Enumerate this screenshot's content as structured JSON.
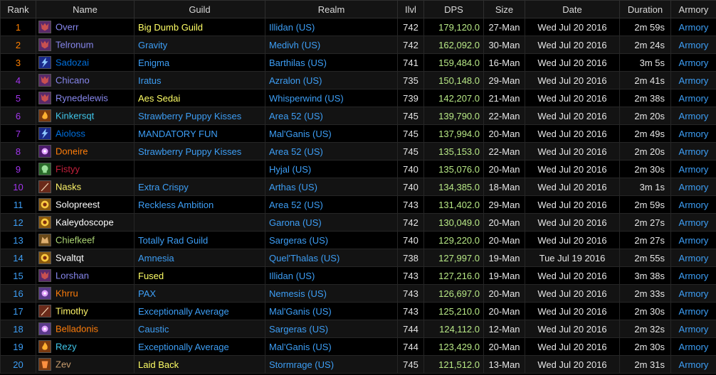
{
  "headers": {
    "rank": "Rank",
    "name": "Name",
    "guild": "Guild",
    "realm": "Realm",
    "ilvl": "Ilvl",
    "dps": "DPS",
    "size": "Size",
    "date": "Date",
    "duration": "Duration",
    "armory": "Armory"
  },
  "colors": {
    "legendary": "#ff8000",
    "epic": "#a335ee",
    "rare": "#0070dd",
    "uncommon": "#1eff00",
    "guild_plain": "#3d9ef5",
    "guild_yellow": "#ffff66",
    "realm": "#3d9ef5",
    "dps": "#b8e986"
  },
  "rows": [
    {
      "rank": "1",
      "name": "Overr",
      "name_color": "#8787ed",
      "icon": "demon-icon",
      "icon_color": "#5a2a6a",
      "guild": "Big Dumb Guild",
      "guild_color": "#ffff66",
      "realm": "Illidan (US)",
      "ilvl": "742",
      "dps": "179,120.0",
      "size": "27-Man",
      "date": "Wed Jul 20 2016",
      "duration": "2m 59s",
      "armory": "Armory",
      "rank_color": "#ff8000"
    },
    {
      "rank": "2",
      "name": "Telronum",
      "name_color": "#8787ed",
      "icon": "demon-icon",
      "icon_color": "#5a2a6a",
      "guild": "Gravity",
      "guild_color": "#3d9ef5",
      "realm": "Medivh (US)",
      "ilvl": "742",
      "dps": "162,092.0",
      "size": "30-Man",
      "date": "Wed Jul 20 2016",
      "duration": "2m 24s",
      "armory": "Armory",
      "rank_color": "#ff8000"
    },
    {
      "rank": "3",
      "name": "Sadozai",
      "name_color": "#0070de",
      "icon": "lightning-icon",
      "icon_color": "#1a2a8a",
      "guild": "Enigma",
      "guild_color": "#3d9ef5",
      "realm": "Barthilas (US)",
      "ilvl": "741",
      "dps": "159,484.0",
      "size": "16-Man",
      "date": "Wed Jul 20 2016",
      "duration": "3m 5s",
      "armory": "Armory",
      "rank_color": "#ff8000"
    },
    {
      "rank": "4",
      "name": "Chicano",
      "name_color": "#8787ed",
      "icon": "demon-icon",
      "icon_color": "#5a2a6a",
      "guild": "Iratus",
      "guild_color": "#3d9ef5",
      "realm": "Azralon (US)",
      "ilvl": "735",
      "dps": "150,148.0",
      "size": "29-Man",
      "date": "Wed Jul 20 2016",
      "duration": "2m 41s",
      "armory": "Armory",
      "rank_color": "#a335ee"
    },
    {
      "rank": "5",
      "name": "Rynedelewis",
      "name_color": "#8787ed",
      "icon": "demon-icon",
      "icon_color": "#5a2a6a",
      "guild": "Aes Sedai",
      "guild_color": "#ffff66",
      "realm": "Whisperwind (US)",
      "ilvl": "739",
      "dps": "142,207.0",
      "size": "21-Man",
      "date": "Wed Jul 20 2016",
      "duration": "2m 38s",
      "armory": "Armory",
      "rank_color": "#a335ee"
    },
    {
      "rank": "6",
      "name": "Kinkersqt",
      "name_color": "#40c7eb",
      "icon": "fire-icon",
      "icon_color": "#7a3a10",
      "guild": "Strawberry Puppy Kisses",
      "guild_color": "#3d9ef5",
      "realm": "Area 52 (US)",
      "ilvl": "745",
      "dps": "139,790.0",
      "size": "22-Man",
      "date": "Wed Jul 20 2016",
      "duration": "2m 20s",
      "armory": "Armory",
      "rank_color": "#a335ee"
    },
    {
      "rank": "7",
      "name": "Aioloss",
      "name_color": "#0070de",
      "icon": "lightning-icon",
      "icon_color": "#1a2a8a",
      "guild": "MANDATORY FUN",
      "guild_color": "#3d9ef5",
      "realm": "Mal'Ganis (US)",
      "ilvl": "745",
      "dps": "137,994.0",
      "size": "20-Man",
      "date": "Wed Jul 20 2016",
      "duration": "2m 49s",
      "armory": "Armory",
      "rank_color": "#a335ee"
    },
    {
      "rank": "8",
      "name": "Doneire",
      "name_color": "#ff7d0a",
      "icon": "arcane-icon",
      "icon_color": "#4a1a6a",
      "guild": "Strawberry Puppy Kisses",
      "guild_color": "#3d9ef5",
      "realm": "Area 52 (US)",
      "ilvl": "745",
      "dps": "135,153.0",
      "size": "22-Man",
      "date": "Wed Jul 20 2016",
      "duration": "2m 20s",
      "armory": "Armory",
      "rank_color": "#a335ee"
    },
    {
      "rank": "9",
      "name": "Fistyy",
      "name_color": "#c41f3b",
      "icon": "skull-icon",
      "icon_color": "#2a6a2a",
      "guild": "",
      "guild_color": "#3d9ef5",
      "realm": "Hyjal (US)",
      "ilvl": "740",
      "dps": "135,076.0",
      "size": "20-Man",
      "date": "Wed Jul 20 2016",
      "duration": "2m 30s",
      "armory": "Armory",
      "rank_color": "#a335ee"
    },
    {
      "rank": "10",
      "name": "Nasks",
      "name_color": "#fff569",
      "icon": "blade-icon",
      "icon_color": "#6a2a1a",
      "guild": "Extra Crispy",
      "guild_color": "#3d9ef5",
      "realm": "Arthas (US)",
      "ilvl": "740",
      "dps": "134,385.0",
      "size": "18-Man",
      "date": "Wed Jul 20 2016",
      "duration": "3m 1s",
      "armory": "Armory",
      "rank_color": "#a335ee"
    },
    {
      "rank": "11",
      "name": "Solopreest",
      "name_color": "#ffffff",
      "icon": "shadow-icon",
      "icon_color": "#8a5a10",
      "guild": "Reckless Ambition",
      "guild_color": "#3d9ef5",
      "realm": "Area 52 (US)",
      "ilvl": "743",
      "dps": "131,402.0",
      "size": "29-Man",
      "date": "Wed Jul 20 2016",
      "duration": "2m 59s",
      "armory": "Armory",
      "rank_color": "#3d9ef5"
    },
    {
      "rank": "12",
      "name": "Kaleydoscope",
      "name_color": "#ffffff",
      "icon": "shadow-icon",
      "icon_color": "#8a5a10",
      "guild": "",
      "guild_color": "#3d9ef5",
      "realm": "Garona (US)",
      "ilvl": "742",
      "dps": "130,049.0",
      "size": "20-Man",
      "date": "Wed Jul 20 2016",
      "duration": "2m 27s",
      "armory": "Armory",
      "rank_color": "#3d9ef5"
    },
    {
      "rank": "13",
      "name": "Chiefkeef",
      "name_color": "#abd473",
      "icon": "beast-icon",
      "icon_color": "#6a4a1a",
      "guild": "Totally Rad Guild",
      "guild_color": "#3d9ef5",
      "realm": "Sargeras (US)",
      "ilvl": "740",
      "dps": "129,220.0",
      "size": "20-Man",
      "date": "Wed Jul 20 2016",
      "duration": "2m 27s",
      "armory": "Armory",
      "rank_color": "#3d9ef5"
    },
    {
      "rank": "14",
      "name": "Svaltqt",
      "name_color": "#ffffff",
      "icon": "shadow-icon",
      "icon_color": "#8a5a10",
      "guild": "Amnesia",
      "guild_color": "#3d9ef5",
      "realm": "Quel'Thalas (US)",
      "ilvl": "738",
      "dps": "127,997.0",
      "size": "19-Man",
      "date": "Tue Jul 19 2016",
      "duration": "2m 55s",
      "armory": "Armory",
      "rank_color": "#3d9ef5"
    },
    {
      "rank": "15",
      "name": "Lorshan",
      "name_color": "#8787ed",
      "icon": "demon-icon",
      "icon_color": "#5a2a6a",
      "guild": "Fused",
      "guild_color": "#ffff66",
      "realm": "Illidan (US)",
      "ilvl": "743",
      "dps": "127,216.0",
      "size": "19-Man",
      "date": "Wed Jul 20 2016",
      "duration": "3m 38s",
      "armory": "Armory",
      "rank_color": "#3d9ef5"
    },
    {
      "rank": "16",
      "name": "Khrru",
      "name_color": "#ff7d0a",
      "icon": "arcane-icon",
      "icon_color": "#5a3a8a",
      "guild": "PAX",
      "guild_color": "#3d9ef5",
      "realm": "Nemesis (US)",
      "ilvl": "743",
      "dps": "126,697.0",
      "size": "20-Man",
      "date": "Wed Jul 20 2016",
      "duration": "2m 33s",
      "armory": "Armory",
      "rank_color": "#3d9ef5"
    },
    {
      "rank": "17",
      "name": "Timothy",
      "name_color": "#fff569",
      "icon": "blade-icon",
      "icon_color": "#6a2a1a",
      "guild": "Exceptionally Average",
      "guild_color": "#3d9ef5",
      "realm": "Mal'Ganis (US)",
      "ilvl": "743",
      "dps": "125,210.0",
      "size": "20-Man",
      "date": "Wed Jul 20 2016",
      "duration": "2m 30s",
      "armory": "Armory",
      "rank_color": "#3d9ef5"
    },
    {
      "rank": "18",
      "name": "Belladonis",
      "name_color": "#ff7d0a",
      "icon": "arcane-icon",
      "icon_color": "#5a3a8a",
      "guild": "Caustic",
      "guild_color": "#3d9ef5",
      "realm": "Sargeras (US)",
      "ilvl": "744",
      "dps": "124,112.0",
      "size": "12-Man",
      "date": "Wed Jul 20 2016",
      "duration": "2m 32s",
      "armory": "Armory",
      "rank_color": "#3d9ef5"
    },
    {
      "rank": "19",
      "name": "Rezy",
      "name_color": "#40c7eb",
      "icon": "fire-icon",
      "icon_color": "#7a3a10",
      "guild": "Exceptionally Average",
      "guild_color": "#3d9ef5",
      "realm": "Mal'Ganis (US)",
      "ilvl": "744",
      "dps": "123,429.0",
      "size": "20-Man",
      "date": "Wed Jul 20 2016",
      "duration": "2m 30s",
      "armory": "Armory",
      "rank_color": "#3d9ef5"
    },
    {
      "rank": "20",
      "name": "Zev",
      "name_color": "#c79c6e",
      "icon": "warrior-icon",
      "icon_color": "#7a3a10",
      "guild": "Laid Back",
      "guild_color": "#ffff66",
      "realm": "Stormrage (US)",
      "ilvl": "745",
      "dps": "121,512.0",
      "size": "13-Man",
      "date": "Wed Jul 20 2016",
      "duration": "2m 31s",
      "armory": "Armory",
      "rank_color": "#3d9ef5"
    }
  ]
}
